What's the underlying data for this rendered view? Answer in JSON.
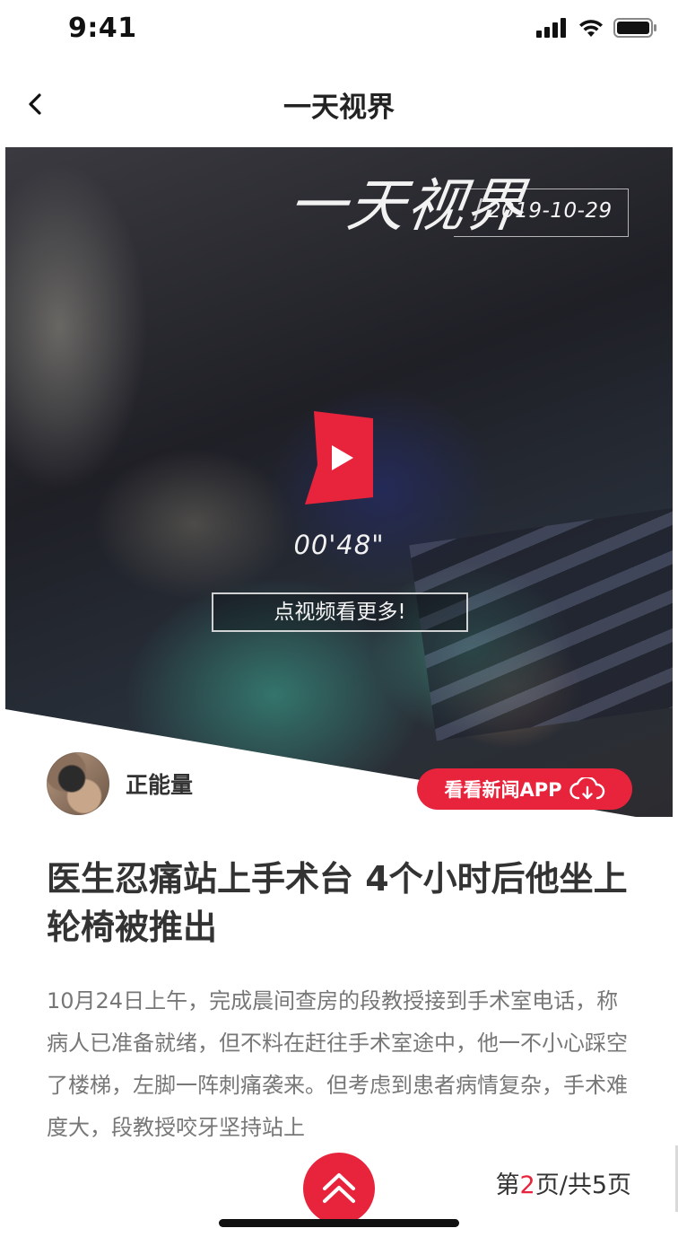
{
  "status_bar": {
    "time": "9:41",
    "icons": [
      "signal-icon",
      "wifi-icon",
      "battery-icon"
    ]
  },
  "nav": {
    "back_icon": "chevron-left-icon",
    "title": "一天视界"
  },
  "video": {
    "brand_logo": "一天视界",
    "brand_date": "2019-10-29",
    "duration": "00'48\"",
    "more_label": "点视频看更多!",
    "play_icon": "play-icon"
  },
  "author": {
    "name": "正能量"
  },
  "app_button": {
    "label": "看看新闻APP",
    "icon": "cloud-download-icon"
  },
  "article": {
    "title": "医生忍痛站上手术台 4个小时后他坐上轮椅被推出",
    "body": "10月24日上午，完成晨间查房的段教授接到手术室电话，称病人已准备就绪，但不料在赶往手术室途中，他一不小心踩空了楼梯，左脚一阵刺痛袭来。但考虑到患者病情复杂，手术难度大，段教授咬牙坚持站上"
  },
  "pager": {
    "prefix": "第",
    "current": "2",
    "suffix": "页/共5页"
  },
  "colors": {
    "accent": "#e8233c",
    "title_text": "#333333",
    "body_text": "#777777"
  }
}
